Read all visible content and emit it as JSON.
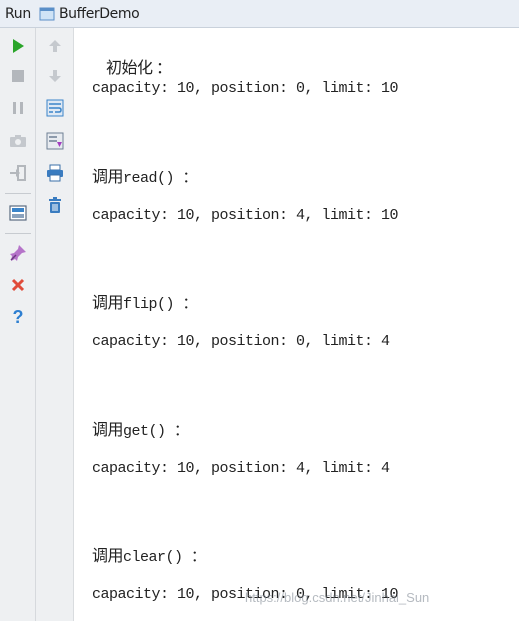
{
  "window": {
    "run_label": "Run",
    "tab_label": "BufferDemo"
  },
  "toolbar": {
    "left": [
      "run-icon",
      "stop-icon",
      "pause-icon",
      "camera-icon",
      "login-icon",
      "layout-icon",
      "pin-icon",
      "close-icon",
      "help-icon"
    ],
    "right": [
      "up-arrow-icon",
      "down-arrow-icon",
      "soft-wrap-icon",
      "scroll-to-end-icon",
      "print-icon",
      "trash-icon"
    ]
  },
  "console": {
    "lines": [
      {
        "head": "初始化 ：",
        "value": "capacity: 10, position: 0, limit: 10"
      },
      {
        "head_cjk": "调用",
        "head_code": "read() ：",
        "value": "capacity: 10, position: 4, limit: 10"
      },
      {
        "head_cjk": "调用",
        "head_code": "flip() ：",
        "value": "capacity: 10, position: 0, limit: 4"
      },
      {
        "head_cjk": "调用",
        "head_code": "get() ：",
        "value": "capacity: 10, position: 4, limit: 4"
      },
      {
        "head_cjk": "调用",
        "head_code": "clear() ：",
        "value": "capacity: 10, position: 0, limit: 10"
      }
    ]
  },
  "watermark": "https://blog.csdn.net/Jinhai_Sun",
  "colors": {
    "run_green": "#2aa52a",
    "stop_gray": "#b3b7bc",
    "close_red": "#e04b3a",
    "help_blue": "#2d7fd1",
    "toolbar_bg": "#eef0f2",
    "title_bg": "#e9eef5"
  }
}
